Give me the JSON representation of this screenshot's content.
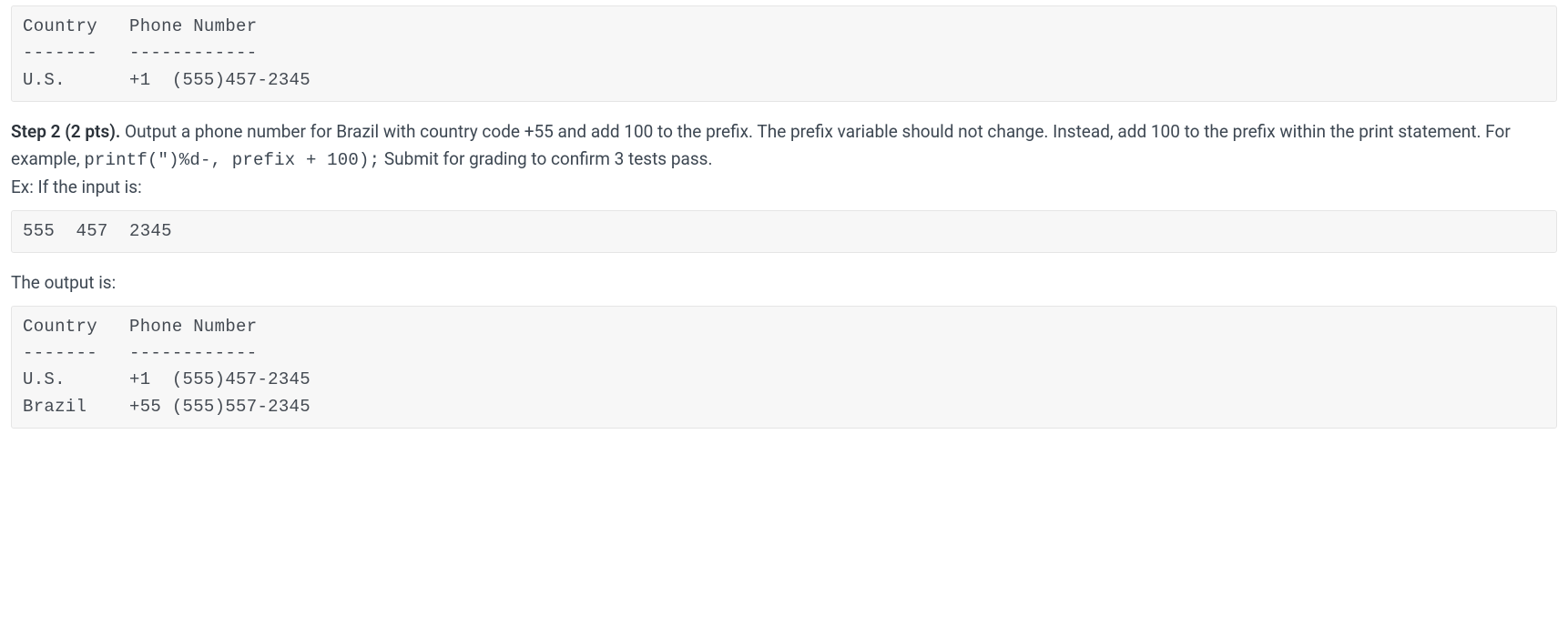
{
  "block1": "Country   Phone Number\n-------   ------------\nU.S.      +1  (555)457-2345",
  "step2_label": "Step 2 (2 pts).",
  "step2_text_a": " Output a phone number for Brazil with country code +55 and add 100 to the prefix. The prefix variable should not change. Instead, add 100 to the prefix within the print statement. For example, ",
  "step2_code": "printf(\")%d-, prefix + 100);",
  "step2_text_b": " Submit for grading to confirm 3 tests pass.",
  "ex_label": "Ex: If the input is:",
  "block2": "555  457  2345",
  "output_label": "The output is:",
  "block3": "Country   Phone Number\n-------   ------------\nU.S.      +1  (555)457-2345\nBrazil    +55 (555)557-2345"
}
